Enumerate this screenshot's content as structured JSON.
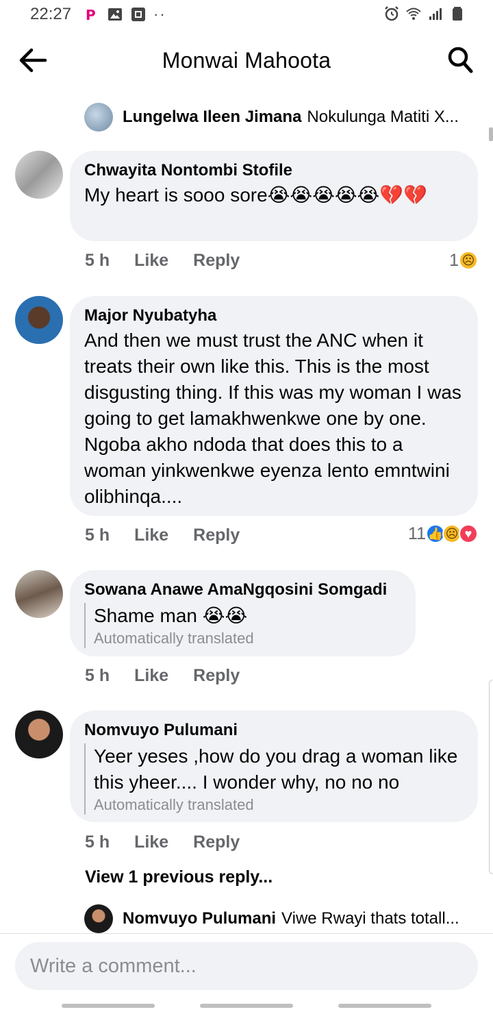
{
  "status_bar": {
    "time": "22:27",
    "dots": "··"
  },
  "header": {
    "title": "Monwai Mahoota"
  },
  "reply_preview_top": {
    "name": "Lungelwa Ileen Jimana",
    "text": "Nokulunga Matiti X..."
  },
  "comments": [
    {
      "name": "Chwayita Nontombi Stofile",
      "text": "My heart is sooo sore😭😭😭😭😭💔💔",
      "time": "5 h",
      "like": "Like",
      "reply": "Reply",
      "reaction_count": "1",
      "reactions": [
        "sad"
      ]
    },
    {
      "name": "Major Nyubatyha",
      "text": "And then we must trust the ANC when it treats their own like this. This is the most disgusting thing. If this was my woman I was going to get lamakhwenkwe one by one. Ngoba akho ndoda that does this to a woman yinkwenkwe eyenza lento emntwini olibhinqa....",
      "time": "5 h",
      "like": "Like",
      "reply": "Reply",
      "reaction_count": "11",
      "reactions": [
        "like",
        "sad",
        "love"
      ]
    },
    {
      "name": "Sowana Anawe AmaNgqosini Somgadi",
      "text": "Shame man 😭😭",
      "translated_label": "Automatically translated",
      "time": "5 h",
      "like": "Like",
      "reply": "Reply"
    },
    {
      "name": "Nomvuyo Pulumani",
      "text": "Yeer yeses ,how do you drag a woman like this yheer.... I wonder why, no no no",
      "translated_label": "Automatically translated",
      "time": "5 h",
      "like": "Like",
      "reply": "Reply"
    }
  ],
  "view_previous": "View 1 previous reply...",
  "reply_preview_bottom": {
    "name": "Nomvuyo Pulumani",
    "text": "Viwe Rwayi thats totall..."
  },
  "composer": {
    "placeholder": "Write a comment..."
  },
  "colors": {
    "bubble": "#f0f2f5",
    "secondary_text": "#65676b",
    "like_blue": "#1877f2",
    "love_red": "#f33e58",
    "sad_yellow": "#f7b928"
  }
}
